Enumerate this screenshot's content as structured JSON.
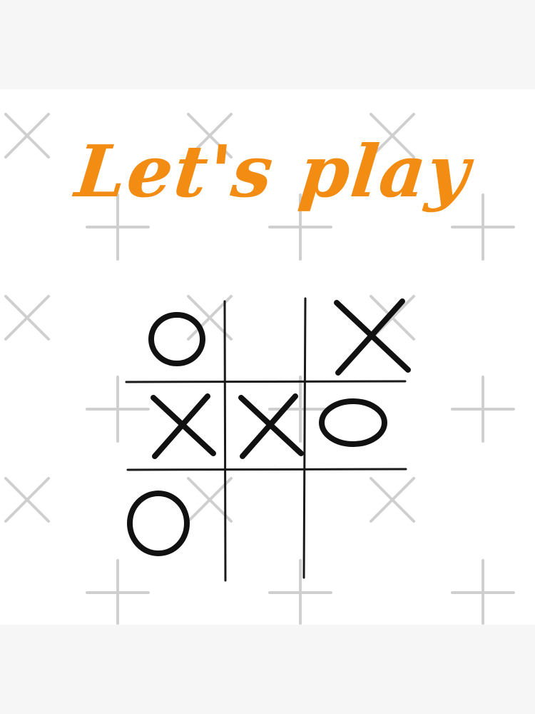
{
  "title": "Let's play",
  "colors": {
    "title": "#f28c13",
    "ink": "#111111",
    "grid": "#1a1a1a",
    "watermark": "#c8c8c8",
    "background": "#ffffff",
    "frame": "#f6f6f6"
  },
  "board": [
    [
      "O",
      "",
      "X"
    ],
    [
      "X",
      "X",
      "O"
    ],
    [
      "O",
      "",
      ""
    ]
  ]
}
